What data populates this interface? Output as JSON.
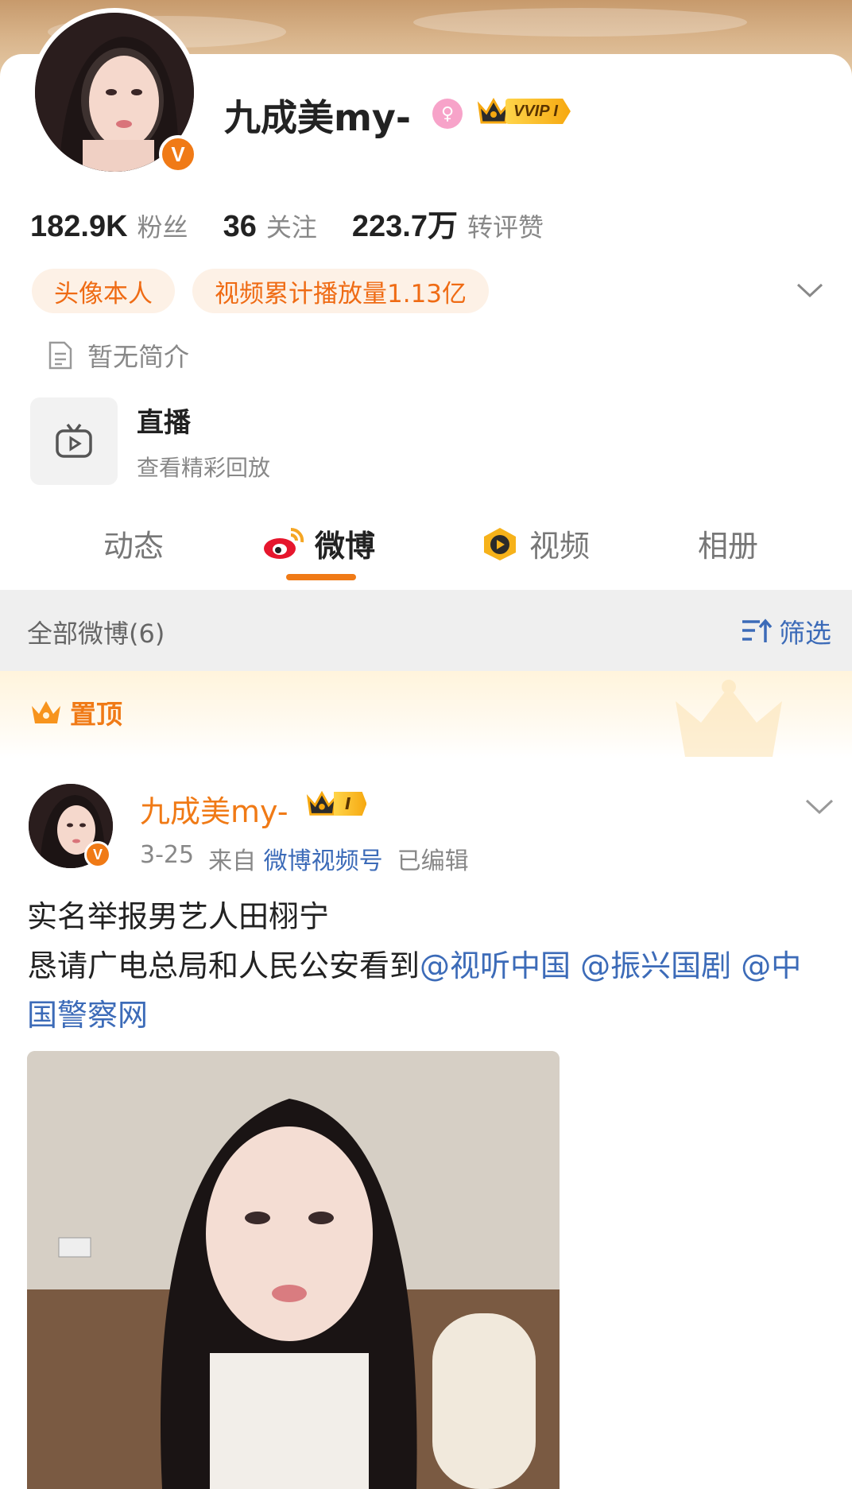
{
  "profile": {
    "name": "九成美my-",
    "vip_label": "VVIP I",
    "stats": [
      {
        "value": "182.9K",
        "label": "粉丝"
      },
      {
        "value": "36",
        "label": "关注"
      },
      {
        "value": "223.7万",
        "label": "转评赞"
      }
    ],
    "tags": [
      "头像本人",
      "视频累计播放量1.13亿"
    ],
    "bio": "暂无简介",
    "live": {
      "title": "直播",
      "subtitle": "查看精彩回放"
    },
    "verified_mark": "V"
  },
  "tabs": [
    {
      "label": "动态",
      "active": false
    },
    {
      "label": "微博",
      "active": true
    },
    {
      "label": "视频",
      "active": false
    },
    {
      "label": "相册",
      "active": false
    }
  ],
  "filter_bar": {
    "all_posts": "全部微博(6)",
    "filter_label": "筛选"
  },
  "pinned": {
    "label": "置顶"
  },
  "post": {
    "author": "九成美my-",
    "level_badge": "I",
    "date": "3-25",
    "from_prefix": "来自",
    "source": "微博视频号",
    "edited": "已编辑",
    "line1": "实名举报男艺人田栩宁",
    "line2": "恳请广电总局和人民公安看到",
    "mentions": [
      "@视听中国",
      "@振兴国剧",
      "@中国警察网"
    ]
  },
  "colors": {
    "accent": "#f07a16",
    "link": "#3c6bb8",
    "gold": "#f6a810"
  }
}
